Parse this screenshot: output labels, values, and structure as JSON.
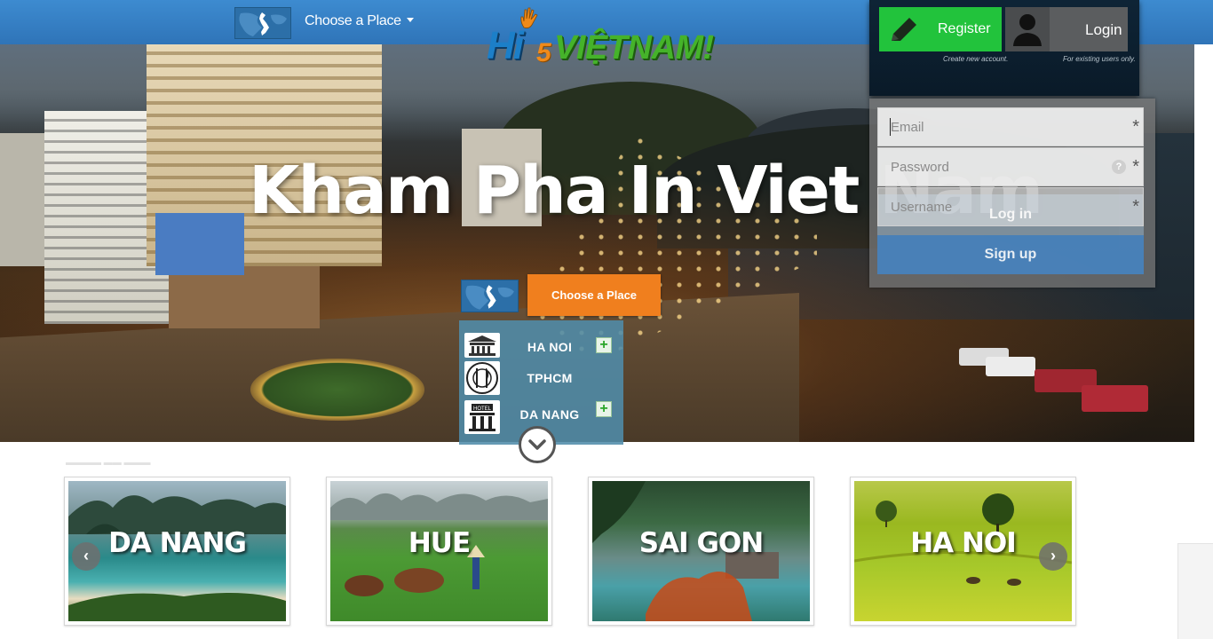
{
  "nav": {
    "choose_place": "Choose a Place",
    "map_icon": "vietnam-map-icon"
  },
  "logo": {
    "hi": "Hi",
    "five": "5",
    "rest": "VIỆTNAM!",
    "colors": {
      "hi": "#1c7fc8",
      "five": "#f08a1a",
      "rest": "#45b32a"
    }
  },
  "hero": {
    "title": "Kham Pha In Viet Nam"
  },
  "account": {
    "register_label": "Register",
    "register_hint": "Create new account.",
    "login_label": "Login",
    "login_hint": "For existing users only.",
    "register_icon": "pencil-icon",
    "login_icon": "user-silhouette-icon",
    "colors": {
      "register": "#22c33c",
      "login": "#5b5d5f"
    }
  },
  "login_form": {
    "email_placeholder": "Email",
    "password_placeholder": "Password",
    "username_placeholder": "Username",
    "required_mark": "*",
    "help_mark": "?",
    "login_button": "Log in",
    "signup_button": "Sign up"
  },
  "place_widget": {
    "choose_button": "Choose a Place",
    "items": [
      {
        "name": "HA NOI",
        "icon": "landmark-icon",
        "plus": "+"
      },
      {
        "name": "TPHCM",
        "icon": "restaurant-icon"
      },
      {
        "name": "DA NANG",
        "icon": "hotel-icon",
        "plus": "+"
      }
    ],
    "scroll_icon": "chevron-down-circle-icon",
    "colors": {
      "button": "#f07f1e"
    }
  },
  "carousel": {
    "faint_heading": "▬▬▬▬ ▬▬  ▬▬▬",
    "cards": [
      {
        "label": "DA NANG"
      },
      {
        "label": "HUE"
      },
      {
        "label": "SAI GON"
      },
      {
        "label": "HA NOI"
      }
    ],
    "prev": "‹",
    "next": "›"
  }
}
